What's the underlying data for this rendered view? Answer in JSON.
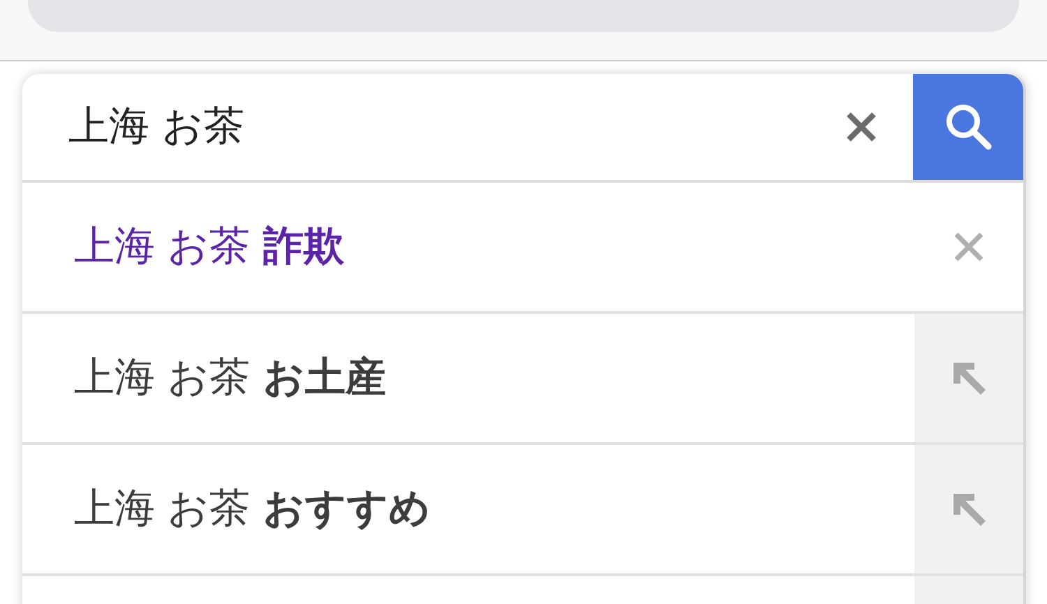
{
  "search": {
    "value": "上海 お茶"
  },
  "suggestions": [
    {
      "kind": "history",
      "text": "上海 お茶 **詐欺**"
    },
    {
      "kind": "suggestion",
      "text": "上海 お茶 **お土産**"
    },
    {
      "kind": "suggestion",
      "text": "上海 お茶 **おすすめ**"
    },
    {
      "kind": "suggestion"
    }
  ]
}
